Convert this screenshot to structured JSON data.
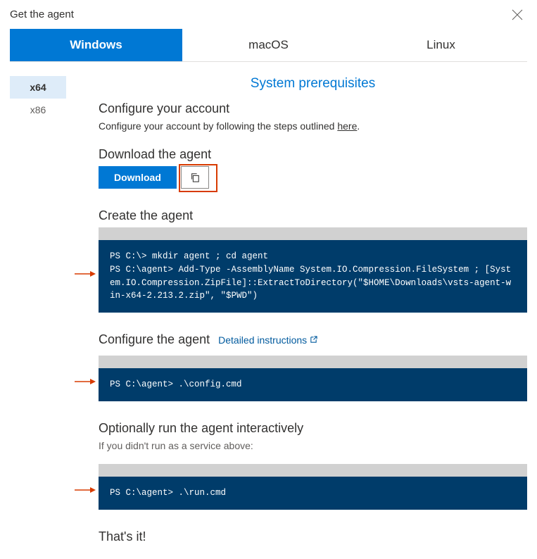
{
  "header": {
    "title": "Get the agent"
  },
  "tabs": {
    "windows": "Windows",
    "macos": "macOS",
    "linux": "Linux"
  },
  "arch": {
    "x64": "x64",
    "x86": "x86"
  },
  "prereq_link": "System prerequisites",
  "sections": {
    "configure_account": {
      "title": "Configure your account",
      "text_pre": "Configure your account by following the steps outlined ",
      "here": "here",
      "text_post": "."
    },
    "download": {
      "title": "Download the agent",
      "button": "Download"
    },
    "create": {
      "title": "Create the agent",
      "code": "PS C:\\> mkdir agent ; cd agent\nPS C:\\agent> Add-Type -AssemblyName System.IO.Compression.FileSystem ; [System.IO.Compression.ZipFile]::ExtractToDirectory(\"$HOME\\Downloads\\vsts-agent-win-x64-2.213.2.zip\", \"$PWD\")"
    },
    "configure_agent": {
      "title": "Configure the agent",
      "link": "Detailed instructions",
      "code": "PS C:\\agent> .\\config.cmd"
    },
    "run": {
      "title": "Optionally run the agent interactively",
      "sub": "If you didn't run as a service above:",
      "code": "PS C:\\agent> .\\run.cmd"
    },
    "done": {
      "title": "That's it!"
    }
  }
}
